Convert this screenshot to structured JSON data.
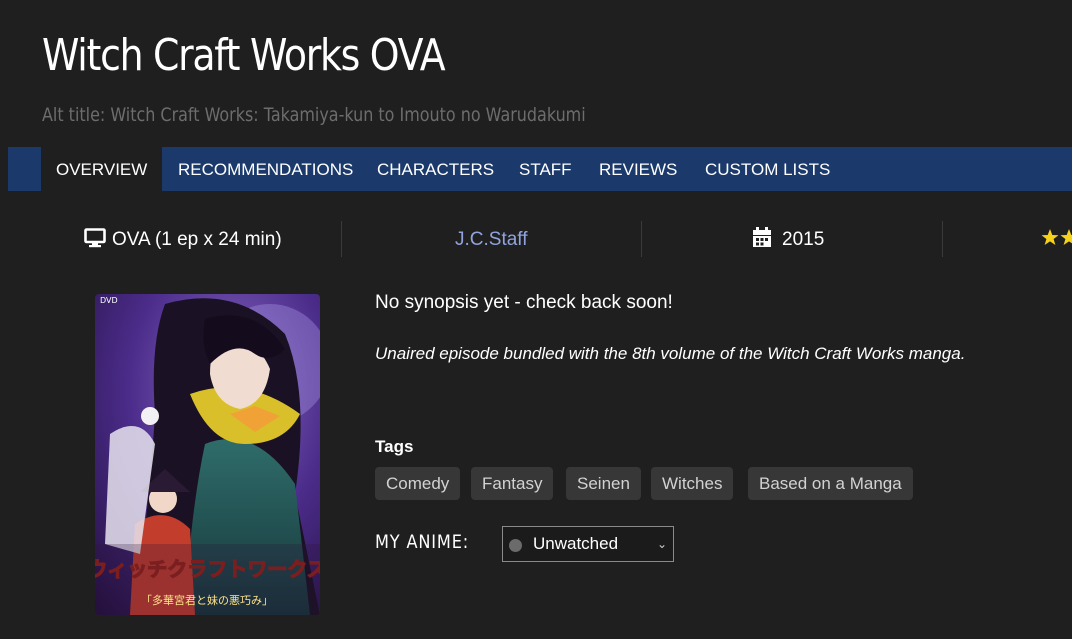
{
  "header": {
    "title": "Witch Craft Works OVA",
    "alt_title": "Alt title: Witch Craft Works: Takamiya-kun to Imouto no Warudakumi"
  },
  "nav": {
    "tabs": [
      {
        "label": "OVERVIEW",
        "active": true
      },
      {
        "label": "RECOMMENDATIONS"
      },
      {
        "label": "CHARACTERS"
      },
      {
        "label": "STAFF"
      },
      {
        "label": "REVIEWS"
      },
      {
        "label": "CUSTOM LISTS"
      }
    ]
  },
  "info": {
    "type_icon": "monitor-icon",
    "type": "OVA (1 ep x 24 min)",
    "studio": "J.C.Staff",
    "year_icon": "calendar-icon",
    "year": "2015",
    "rating_icon": "stars-icon"
  },
  "main": {
    "synopsis": "No synopsis yet - check back soon!",
    "note": "Unaired episode bundled with the 8th volume of the Witch Craft Works manga.",
    "tags_label": "Tags",
    "tags": [
      "Comedy",
      "Fantasy",
      "Seinen",
      "Witches",
      "Based on a Manga"
    ],
    "my_anime_label": "MY ANIME:",
    "status": {
      "value": "Unwatched",
      "dot_color": "#6b6b6b"
    }
  },
  "poster": {
    "dvd_label": "DVD",
    "logo_text": "ウィッチクラフトワークス",
    "subtitle_text": "「多華宮君と妹の悪巧み」"
  },
  "colors": {
    "background": "#1f1f1f",
    "nav_bar": "#1b3a6b",
    "studio_link": "#8fa3dd",
    "tag_bg": "#373737"
  }
}
